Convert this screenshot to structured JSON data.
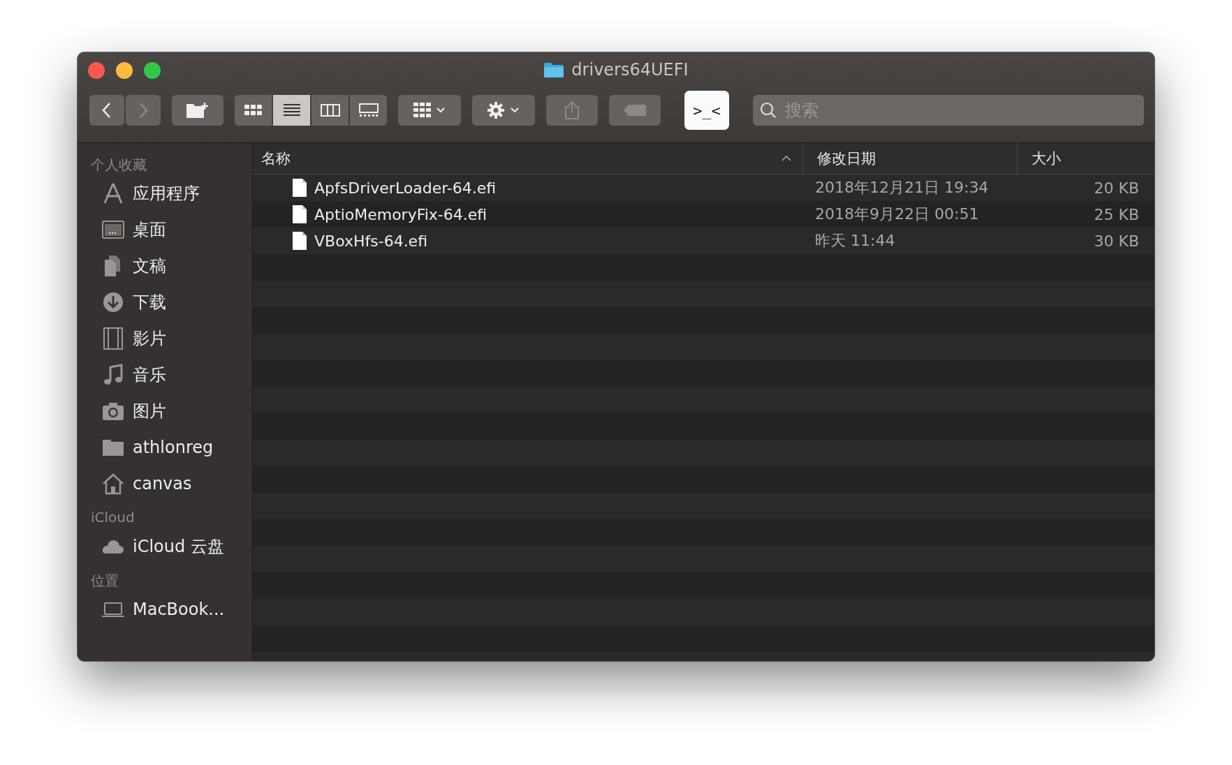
{
  "window": {
    "title": "drivers64UEFI"
  },
  "toolbar": {
    "back_enabled": true,
    "forward_enabled": false,
    "view_modes": [
      {
        "kind": "icons",
        "selected": false
      },
      {
        "kind": "list",
        "selected": true
      },
      {
        "kind": "columns",
        "selected": false
      },
      {
        "kind": "gallery",
        "selected": false
      }
    ],
    "terminal_button": ">_<",
    "search": {
      "placeholder": "搜索"
    }
  },
  "sidebar": {
    "sections": [
      {
        "title": "个人收藏",
        "items": [
          {
            "label": "应用程序",
            "kind": "apps"
          },
          {
            "label": "桌面",
            "kind": "desktop"
          },
          {
            "label": "文稿",
            "kind": "documents"
          },
          {
            "label": "下载",
            "kind": "downloads"
          },
          {
            "label": "影片",
            "kind": "movies"
          },
          {
            "label": "音乐",
            "kind": "music"
          },
          {
            "label": "图片",
            "kind": "pictures"
          },
          {
            "label": "athlonreg",
            "kind": "folder"
          },
          {
            "label": "canvas",
            "kind": "home"
          }
        ]
      },
      {
        "title": "iCloud",
        "items": [
          {
            "label": "iCloud 云盘",
            "kind": "cloud"
          }
        ]
      },
      {
        "title": "位置",
        "items": [
          {
            "label": "MacBook...",
            "kind": "laptop"
          }
        ]
      }
    ]
  },
  "table": {
    "columns": [
      {
        "label": "名称",
        "sorted": true
      },
      {
        "label": "修改日期",
        "sorted": false
      },
      {
        "label": "大小",
        "sorted": false
      }
    ],
    "rows": [
      {
        "name": "ApfsDriverLoader-64.efi",
        "date": "2018年12月21日 19:34",
        "size": "20 KB"
      },
      {
        "name": "AptioMemoryFix-64.efi",
        "date": "2018年9月22日 00:51",
        "size": "25 KB"
      },
      {
        "name": "VBoxHfs-64.efi",
        "date": "昨天 11:44",
        "size": "30 KB"
      }
    ]
  }
}
